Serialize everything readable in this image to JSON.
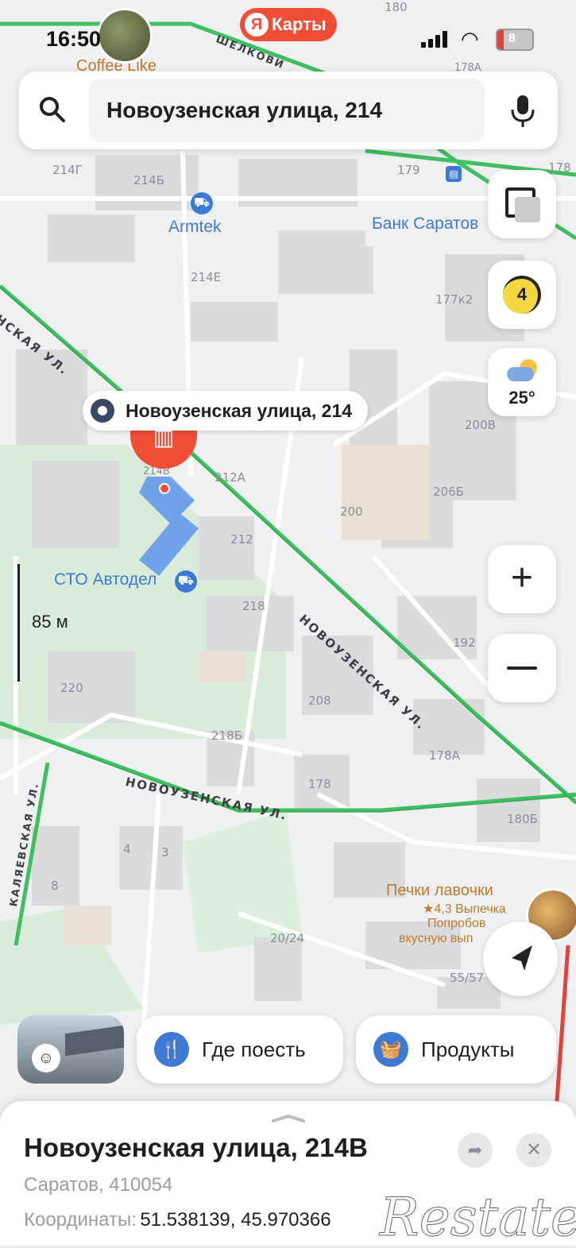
{
  "status_bar": {
    "time": "16:50"
  },
  "brand": {
    "label": "Карты",
    "logo_letter": "Я"
  },
  "search": {
    "value": "Новоузенская улица, 214"
  },
  "layers": {
    "traffic_level": "4",
    "weather_temp": "25°"
  },
  "map": {
    "marker_label": "Новоузенская улица, 214",
    "scale_label": "85 м",
    "pois": {
      "armtek": "Armtek",
      "bank": "Банк Саратов",
      "sto": "СТО Автодел",
      "bakery_name": "Печки лавочки",
      "bakery_rating": "★4,3 Выпечка",
      "bakery_line2": "Попробов",
      "bakery_line3": "вкусную вып",
      "coffee": "Coffee Like"
    },
    "streets": {
      "novouz_1": "НОВОУЗЕНСКАЯ УЛ.",
      "novouz_2": "НОВОУЗЕНСКАЯ УЛ.",
      "novouz_3": "ЕНСКАЯ УЛ.",
      "kalyaev": "КАЛЯЕВСКАЯ УЛ.",
      "shelk": "ШЕЛКОВИ"
    },
    "numbers": [
      "214Г",
      "214Б",
      "214Е",
      "179",
      "178",
      "177к2",
      "200В",
      "206Б",
      "200",
      "212А",
      "212",
      "218",
      "192",
      "208",
      "220",
      "218Б",
      "178А",
      "178",
      "180Б",
      "4",
      "3",
      "8",
      "20/24",
      "55/57",
      "180",
      "178А",
      "214В"
    ]
  },
  "chips": {
    "eat": "Где поесть",
    "products": "Продукты"
  },
  "sheet": {
    "title": "Новоузенская улица, 214В",
    "subtitle": "Саратов, 410054",
    "coords_label": "Координаты:",
    "coords_value": "51.538139, 45.970366"
  },
  "watermark": "Restate",
  "colors": {
    "traffic_green": "#3fbf5f",
    "marker_red": "#f04e37",
    "poi_blue": "#3e7ad3",
    "building_blue": "#6fa2e8"
  }
}
